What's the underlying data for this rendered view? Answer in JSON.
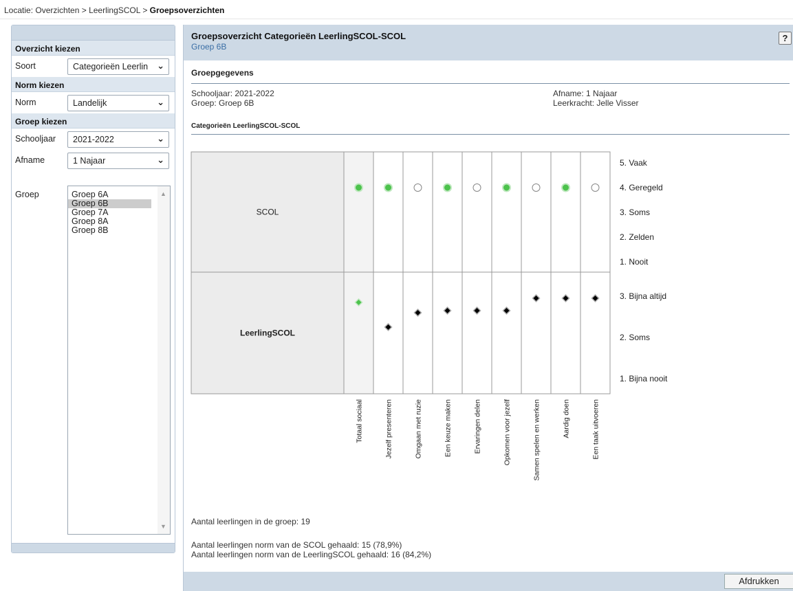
{
  "breadcrumb": {
    "prefix": "Locatie: Overzichten > LeerlingSCOL > ",
    "current": "Groepsoverzichten"
  },
  "sidebar": {
    "sections": {
      "overzicht": "Overzicht kiezen",
      "norm": "Norm kiezen",
      "groep": "Groep kiezen"
    },
    "soort": {
      "label": "Soort",
      "value": "Categorieën Leerlin"
    },
    "norm": {
      "label": "Norm",
      "value": "Landelijk"
    },
    "schooljaar": {
      "label": "Schooljaar",
      "value": "2021-2022"
    },
    "afname": {
      "label": "Afname",
      "value": "1 Najaar"
    },
    "groep": {
      "label": "Groep",
      "options": [
        "Groep 6A",
        "Groep 6B",
        "Groep 7A",
        "Groep 8A",
        "Groep 8B"
      ],
      "selected": "Groep 6B"
    }
  },
  "main": {
    "title": "Groepsoverzicht Categorieën LeerlingSCOL-SCOL",
    "subtitle": "Groep 6B",
    "help": "?",
    "groepgegevens": "Groepgegevens",
    "schooljaar": "Schooljaar: 2021-2022",
    "groep": "Groep: Groep 6B",
    "afname": "Afname: 1 Najaar",
    "leerkracht": "Leerkracht: Jelle Visser",
    "categorie_title": "Categorieën LeerlingSCOL-SCOL",
    "aantal": "Aantal leerlingen in de groep: 19",
    "norm_scol": "Aantal leerlingen norm van de SCOL gehaald: 15 (78,9%)",
    "norm_leerling": "Aantal leerlingen norm van de LeerlingSCOL gehaald: 16 (84,2%)",
    "print_button": "Afdrukken"
  },
  "colors": {
    "panel_header": "#cdd9e5",
    "green_dot": "#4cc24c",
    "diamond": "#000000"
  },
  "chart_data": {
    "type": "scatter",
    "categories": [
      "Totaal sociaal",
      "Jezelf presenteren",
      "Omgaan met ruzie",
      "Een keuze maken",
      "Ervaringen delen",
      "Opkomen voor jezelf",
      "Samen spelen en werken",
      "Aardig doen",
      "Een taak uitvoeren"
    ],
    "panels": [
      {
        "name": "SCOL",
        "scale_labels": [
          "5. Vaak",
          "4. Geregeld",
          "3. Soms",
          "2. Zelden",
          "1. Nooit"
        ],
        "ylim": [
          1,
          5
        ],
        "values": [
          4,
          4,
          4,
          4,
          4,
          4,
          4,
          4,
          4
        ],
        "norm_reached": [
          true,
          true,
          false,
          true,
          false,
          true,
          false,
          true,
          false
        ]
      },
      {
        "name": "LeerlingSCOL",
        "scale_labels": [
          "3. Bijna altijd",
          "2. Soms",
          "1. Bijna nooit"
        ],
        "ylim": [
          1,
          3
        ],
        "values": [
          2.85,
          2.25,
          2.6,
          2.65,
          2.65,
          2.65,
          2.95,
          2.95,
          2.95
        ],
        "highlight": [
          true,
          false,
          false,
          false,
          false,
          false,
          false,
          false,
          false
        ]
      }
    ]
  }
}
